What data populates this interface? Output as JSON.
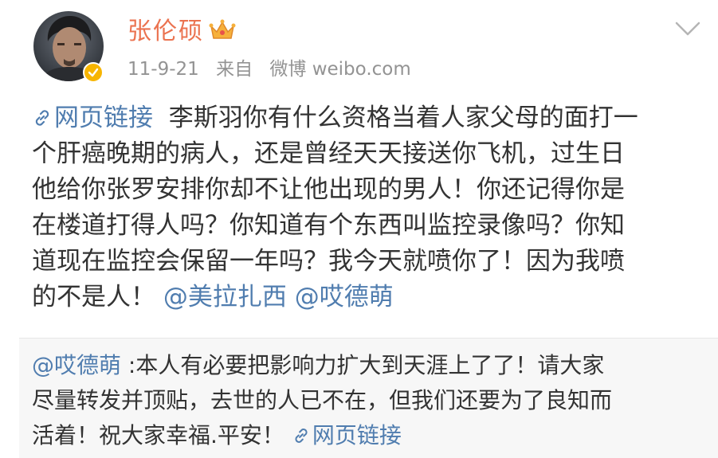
{
  "post": {
    "author": "张伦硕",
    "date": "11-9-21",
    "source_prefix": "来自",
    "source": "微博 weibo.com",
    "icons": {
      "crown": "crown-icon",
      "verify": "verified-badge-icon",
      "menu": "chevron-down-icon",
      "link": "link-icon"
    },
    "colors": {
      "author": "#eb7350",
      "link": "#507daf",
      "meta": "#939393",
      "text": "#333333",
      "repost_bg": "#f7f7f7",
      "verify_badge": "#f7b500"
    },
    "body": {
      "link_label": "网页链接",
      "line1_text": "  李斯羽你有什么资格当着人家父母的面打一",
      "line2": "个肝癌晚期的病人，还是曾经天天接送你飞机，过生日",
      "line3": "他给你张罗安排你却不让他出现的男人！你还记得你是",
      "line4": "在楼道打得人吗？你知道有个东西叫监控录像吗？你知",
      "line5": "道现在监控会保留一年吗？我今天就喷你了！因为我喷",
      "line6_text": "的不是人！",
      "mention1": "@美拉扎西",
      "mention2": "@哎德萌"
    },
    "repost": {
      "mention": "@哎德萌",
      "line1_text": " :本人有必要把影响力扩大到天涯上了了！请大家",
      "line2": "尽量转发并顶贴，去世的人已不在，但我们还要为了良知而",
      "line3_text": "活着！祝大家幸福.平安！",
      "link_label": "网页链接"
    }
  }
}
